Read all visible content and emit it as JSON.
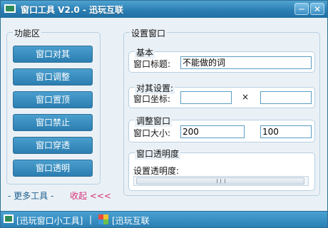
{
  "window": {
    "title": "窗口工具 V2.0 - 迅玩互联",
    "minimize_glyph": "─",
    "close_glyph": "✕"
  },
  "function_area": {
    "title": "功能区",
    "buttons": [
      "窗口对其",
      "窗口调整",
      "窗口置顶",
      "窗口禁止",
      "窗口穿透",
      "窗口透明"
    ]
  },
  "links": {
    "more": "- 更多工具 -",
    "collapse": "收起 <<<"
  },
  "settings": {
    "title": "设置窗口",
    "basic": {
      "title": "基本",
      "label": "窗口标题:",
      "value": "不能做的词"
    },
    "align": {
      "title": "对其设置:",
      "label": "窗口坐标:",
      "x_value": "",
      "y_value": "",
      "sep": "×"
    },
    "adjust": {
      "title": "调整窗口",
      "label": "窗口大小:",
      "width_value": "200",
      "height_value": "100",
      "sep": "×"
    },
    "opacity": {
      "title": "窗口透明度",
      "label": "设置透明度:"
    }
  },
  "statusbar": {
    "item1": "[迅玩窗口小工具]",
    "sep": "|",
    "item2": "[迅玩互联"
  },
  "icons": {
    "title_icon": "window-icon",
    "status_icon_1": "window-icon",
    "status_icon_2": "colorful-logo-icon"
  }
}
